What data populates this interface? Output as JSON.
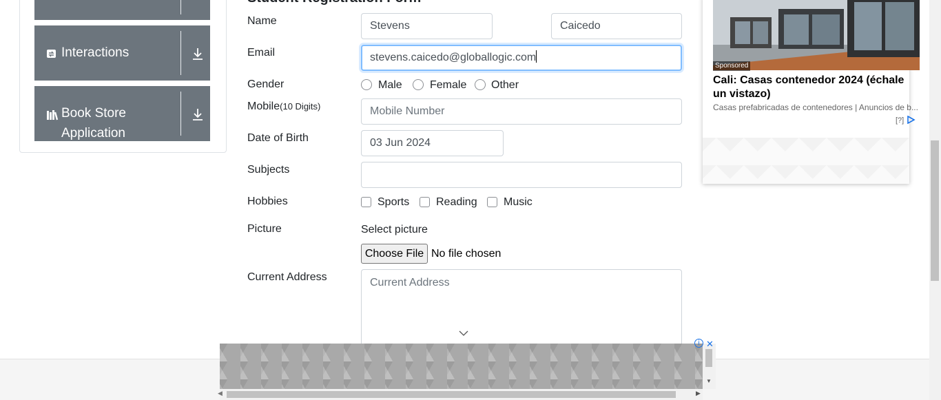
{
  "sidebar": {
    "groups": [
      {
        "label": "",
        "icon": "menu-icon"
      },
      {
        "label": "Interactions",
        "icon": "interactions-icon"
      },
      {
        "label": "Book Store Application",
        "icon": "books-icon"
      }
    ]
  },
  "form": {
    "title": "Student Registration Form",
    "name_label": "Name",
    "first_name_value": "Stevens",
    "last_name_value": "Caicedo",
    "email_label": "Email",
    "email_value": "stevens.caicedo@globallogic.com",
    "gender_label": "Gender",
    "gender_options": [
      "Male",
      "Female",
      "Other"
    ],
    "mobile_label": "Mobile",
    "mobile_hint": "(10 Digits)",
    "mobile_placeholder": "Mobile Number",
    "dob_label": "Date of Birth",
    "dob_value": "03 Jun 2024",
    "subjects_label": "Subjects",
    "subjects_value": "",
    "hobbies_label": "Hobbies",
    "hobby_options": [
      "Sports",
      "Reading",
      "Music"
    ],
    "picture_label": "Picture",
    "picture_prompt": "Select picture",
    "choose_file_label": "Choose File",
    "file_status": "No file chosen",
    "address_label": "Current Address",
    "address_placeholder": "Current Address"
  },
  "ad": {
    "sponsored": "Sponsored",
    "headline": "Cali: Casas contenedor 2024 (échale un vistazo)",
    "description": "Casas prefabricadas de contenedores | Anuncios de b...",
    "help": "[?]"
  },
  "colors": {
    "sidebar_bg": "#6c757d",
    "focus_border": "#80bdff",
    "ad_brand": "#1a73e8"
  }
}
